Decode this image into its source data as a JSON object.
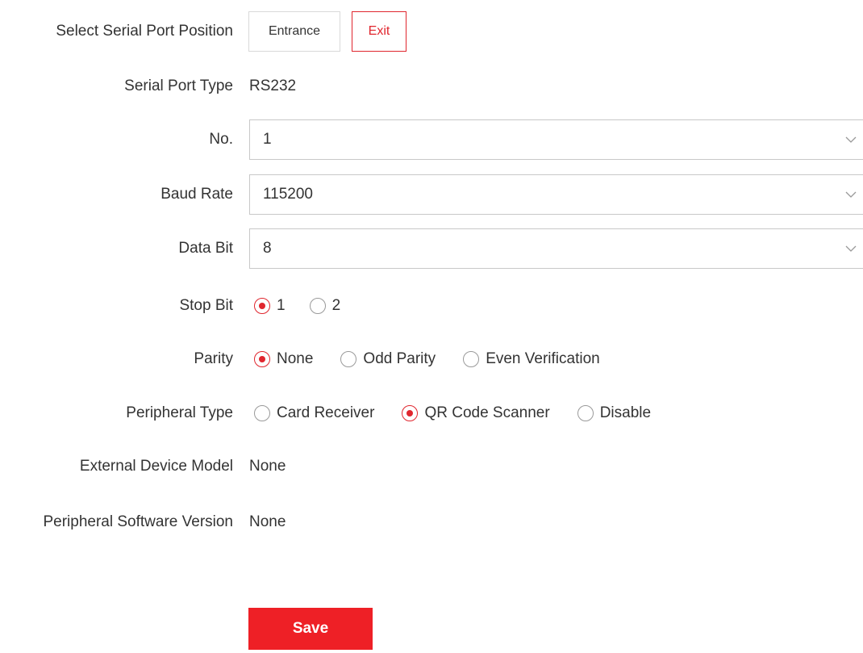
{
  "serial_port_position": {
    "label": "Select Serial Port Position",
    "options": [
      "Entrance",
      "Exit"
    ],
    "selected": "Exit"
  },
  "serial_port_type": {
    "label": "Serial Port Type",
    "value": "RS232"
  },
  "no": {
    "label": "No.",
    "value": "1"
  },
  "baud_rate": {
    "label": "Baud Rate",
    "value": "115200"
  },
  "data_bit": {
    "label": "Data Bit",
    "value": "8"
  },
  "stop_bit": {
    "label": "Stop Bit",
    "options": [
      "1",
      "2"
    ],
    "selected": "1"
  },
  "parity": {
    "label": "Parity",
    "options": [
      "None",
      "Odd Parity",
      "Even Verification"
    ],
    "selected": "None"
  },
  "peripheral_type": {
    "label": "Peripheral Type",
    "options": [
      "Card Receiver",
      "QR Code Scanner",
      "Disable"
    ],
    "selected": "QR Code Scanner"
  },
  "external_device_model": {
    "label": "External Device Model",
    "value": "None"
  },
  "peripheral_software_version": {
    "label": "Peripheral Software Version",
    "value": "None"
  },
  "save_label": "Save",
  "colors": {
    "accent": "#e0262e",
    "save_bg": "#ee2026",
    "text": "#333333",
    "border": "#c8c8c8"
  },
  "icons": {
    "select_arrow": "chevron-down-icon",
    "radio_checked": "radio-checked-icon",
    "radio_unchecked": "radio-unchecked-icon"
  }
}
